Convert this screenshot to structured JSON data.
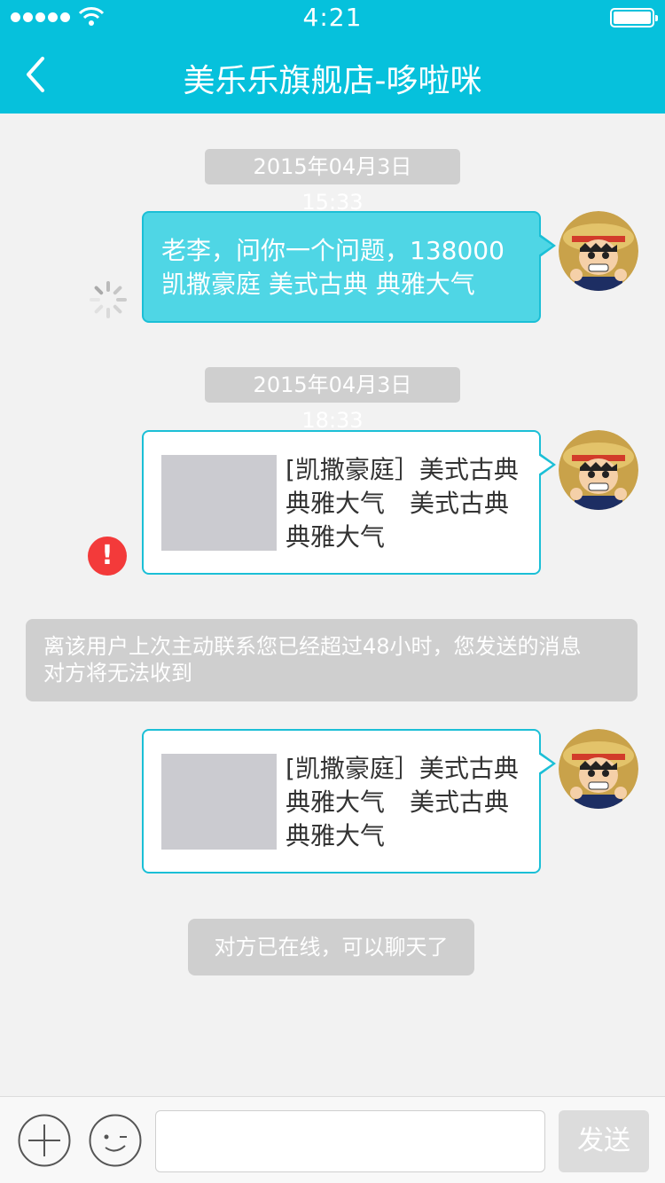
{
  "status_bar": {
    "time": "4:21"
  },
  "header": {
    "title": "美乐乐旗舰店-哆啦咪"
  },
  "messages": {
    "time1": "2015年04月3日 15:33",
    "msg1_line1": "老李，问你一个问题，138000",
    "msg1_line2": "凯撒豪庭 美式古典 典雅大气",
    "time2": "2015年04月3日 18:33",
    "card1_line1": "[凯撒豪庭］美式古典",
    "card1_line2": "典雅大气　美式古典",
    "card1_line3": "典雅大气",
    "notice_line1": "离该用户上次主动联系您已经超过48小时，您发送的消息",
    "notice_line2": "对方将无法收到",
    "card2_line1": "[凯撒豪庭］美式古典",
    "card2_line2": "典雅大气　美式古典",
    "card2_line3": "典雅大气",
    "online_notice": "对方已在线，可以聊天了"
  },
  "input_bar": {
    "send_label": "发送",
    "input_value": ""
  },
  "icons": {
    "error": "!",
    "error_color": "#f33a3a",
    "accent": "#06c1dc"
  }
}
